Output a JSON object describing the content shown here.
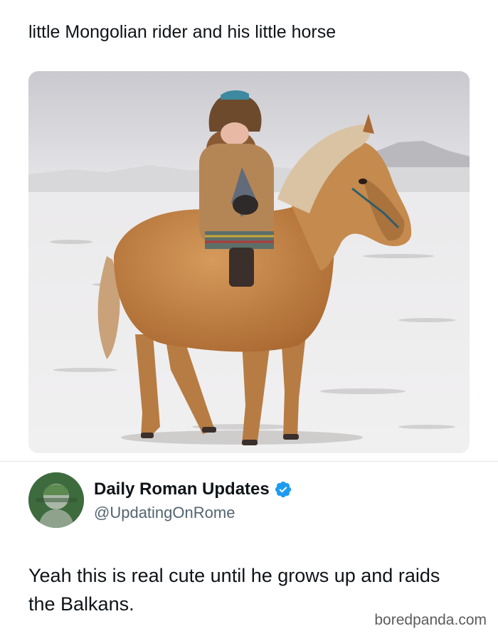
{
  "post": {
    "text": "little Mongolian rider and his little horse"
  },
  "photo": {
    "name": "photo of a child on a small horse in snow"
  },
  "reply": {
    "display_name": "Daily Roman Updates",
    "handle": "@UpdatingOnRome",
    "verified_icon": "verified-badge-icon",
    "text": "Yeah this is real cute until he grows up and raids the Balkans."
  },
  "watermark": "boredpanda.com",
  "colors": {
    "verified": "#1d9bf0",
    "handle": "#536471",
    "text": "#0f1419"
  }
}
